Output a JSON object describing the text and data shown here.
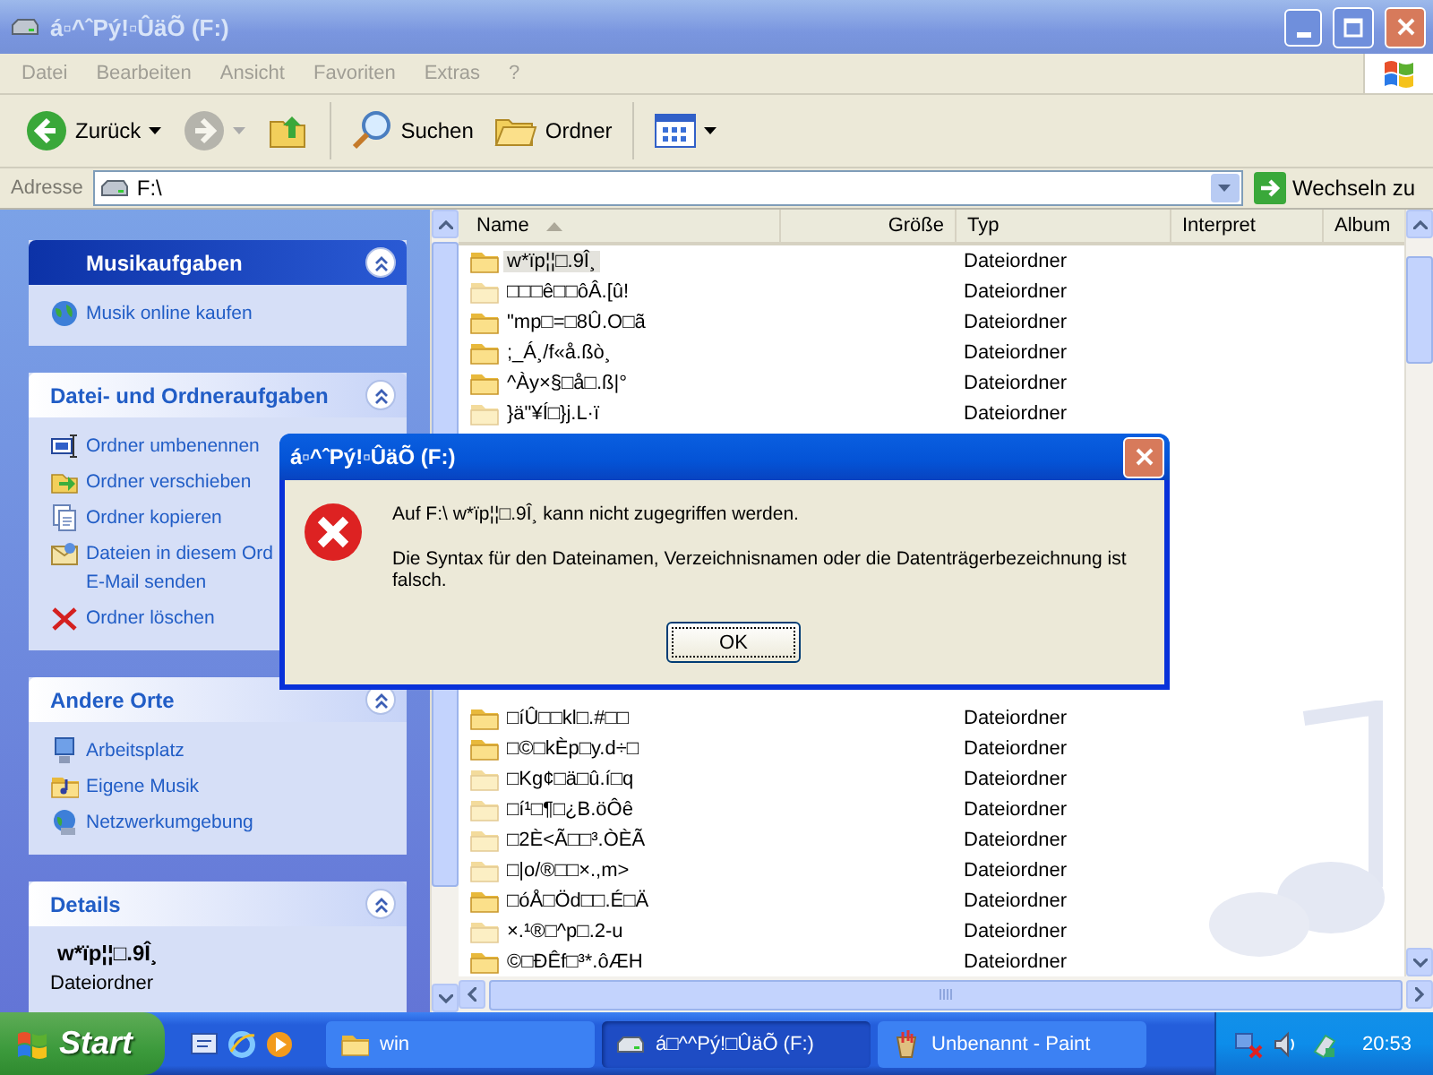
{
  "window": {
    "title": "á▫^ˆPý!▫ÛäÕ (F:)",
    "active": false
  },
  "menu": [
    "Datei",
    "Bearbeiten",
    "Ansicht",
    "Favoriten",
    "Extras",
    "?"
  ],
  "toolbar": [
    {
      "kind": "back",
      "label": "Zurück",
      "disabled": false
    },
    {
      "kind": "forward",
      "disabled": true
    },
    {
      "kind": "up",
      "disabled": false
    },
    {
      "kind": "search",
      "label": "Suchen",
      "disabled": false
    },
    {
      "kind": "folders",
      "label": "Ordner",
      "disabled": false
    },
    {
      "kind": "views",
      "disabled": false
    }
  ],
  "address": {
    "label": "Adresse",
    "value": "F:\\",
    "go": "Wechseln zu"
  },
  "task_panels": [
    {
      "title": "Musikaufgaben",
      "special": true,
      "items": [
        {
          "kind": "globe",
          "label": "Musik online kaufen"
        }
      ]
    },
    {
      "title": "Datei- und Ordneraufgaben",
      "special": false,
      "items": [
        {
          "kind": "rename",
          "label": "Ordner umbenennen"
        },
        {
          "kind": "move",
          "label": "Ordner verschieben"
        },
        {
          "kind": "copy",
          "label": "Ordner kopieren"
        },
        {
          "kind": "mail",
          "label": "Dateien in diesem Ord",
          "label2": "E-Mail senden"
        },
        {
          "kind": "delete",
          "label": "Ordner löschen"
        }
      ]
    },
    {
      "title": "Andere Orte",
      "special": false,
      "items": [
        {
          "kind": "computer",
          "label": "Arbeitsplatz"
        },
        {
          "kind": "music",
          "label": "Eigene Musik"
        },
        {
          "kind": "network",
          "label": "Netzwerkumgebung"
        }
      ]
    }
  ],
  "details": {
    "title": "Details",
    "name": "w*ïp¦¦□.9Î¸",
    "type": "Dateiordner"
  },
  "columns": [
    {
      "label": "Name",
      "sorted": true
    },
    {
      "label": "Größe",
      "sorted": false
    },
    {
      "label": "Typ",
      "sorted": false
    },
    {
      "label": "Interpret",
      "sorted": false
    },
    {
      "label": "Album",
      "sorted": false
    }
  ],
  "rows": [
    {
      "name": "w*ïp¦¦□.9Î¸",
      "type": "Dateiordner",
      "selected": true,
      "hidden": false
    },
    {
      "name": "□□□ê□□ôÂ.[û!",
      "type": "Dateiordner",
      "selected": false,
      "hidden": true
    },
    {
      "name": "\"mp□=□8Û.O□ã",
      "type": "Dateiordner",
      "selected": false,
      "hidden": false
    },
    {
      "name": ";_Á¸/f«å.ßò¸",
      "type": "Dateiordner",
      "selected": false,
      "hidden": false
    },
    {
      "name": "^Ày×§□å□.ß|°",
      "type": "Dateiordner",
      "selected": false,
      "hidden": false
    },
    {
      "name": "}ä\"¥Í□}j.L·ï",
      "type": "Dateiordner",
      "selected": false,
      "hidden": true
    },
    {
      "name": "□íÛ□□kl□.#□□",
      "type": "Dateiordner",
      "selected": false,
      "hidden": false
    },
    {
      "name": "□©□kÈp□y.d÷□",
      "type": "Dateiordner",
      "selected": false,
      "hidden": false
    },
    {
      "name": "□Kg¢□ä□û.í□q",
      "type": "Dateiordner",
      "selected": false,
      "hidden": true
    },
    {
      "name": "□í¹□¶□¿B.öÔê",
      "type": "Dateiordner",
      "selected": false,
      "hidden": true
    },
    {
      "name": "□2È<Ã□□³.ÒÈÃ",
      "type": "Dateiordner",
      "selected": false,
      "hidden": true
    },
    {
      "name": "□|o/®□□×.,m>",
      "type": "Dateiordner",
      "selected": false,
      "hidden": true
    },
    {
      "name": "□óÅ□Öd□□.É□Ä",
      "type": "Dateiordner",
      "selected": false,
      "hidden": false
    },
    {
      "name": "×.¹®□^p□.2-u",
      "type": "Dateiordner",
      "selected": false,
      "hidden": true
    },
    {
      "name": "©□ÐÊf□³*.ôÆH",
      "type": "Dateiordner",
      "selected": false,
      "hidden": false
    }
  ],
  "dialog": {
    "title": "á▫^ˆPý!▫ÛäÕ (F:)",
    "message": "Auf F:\\ w*ïp¦¦□.9Î¸ kann nicht zugegriffen werden.",
    "detail": "Die Syntax für den Dateinamen, Verzeichnisnamen oder die Datenträgerbezeichnung ist falsch.",
    "button": "OK"
  },
  "taskbar": {
    "start": "Start",
    "tasks": [
      {
        "kind": "folder",
        "label": "win",
        "selected": false
      },
      {
        "kind": "drive",
        "label": "á□^^Pý!□ÛäÕ (F:)",
        "selected": true
      },
      {
        "kind": "paint",
        "label": "Unbenannt - Paint",
        "selected": false
      }
    ],
    "clock": "20:53"
  }
}
